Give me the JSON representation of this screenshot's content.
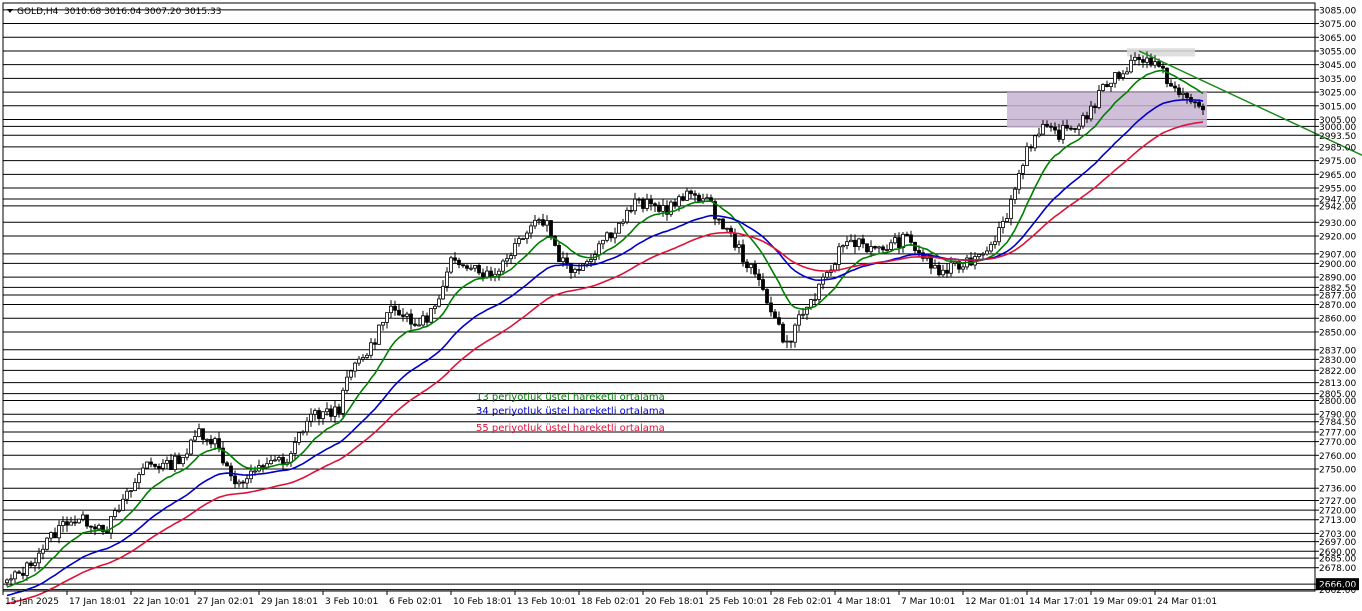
{
  "header": {
    "symbol": "GOLD,H4",
    "ohlc": "3010.68 3016.04 3007.20 3015.33"
  },
  "chart_data": {
    "type": "line",
    "title": "GOLD,H4",
    "ylim": [
      2661,
      3090
    ],
    "grid": false,
    "price_levels": [
      "3085.00",
      "3075.00",
      "3065.00",
      "3055.00",
      "3045.00",
      "3035.00",
      "3025.00",
      "3015.00",
      "3005.00",
      "3000.00",
      "2993.50",
      "2985.00",
      "2975.00",
      "2965.00",
      "2955.00",
      "2947.00",
      "2942.00",
      "2930.00",
      "2920.00",
      "2907.00",
      "2900.00",
      "2890.00",
      "2882.50",
      "2877.00",
      "2870.00",
      "2860.00",
      "2850.00",
      "2837.00",
      "2830.00",
      "2822.00",
      "2813.00",
      "2805.00",
      "2800.00",
      "2790.00",
      "2784.50",
      "2777.00",
      "2770.00",
      "2760.00",
      "2750.00",
      "2736.00",
      "2727.00",
      "2720.00",
      "2713.00",
      "2703.00",
      "2697.00",
      "2690.00",
      "2685.00",
      "2678.00",
      "2666.00",
      "2662.00"
    ],
    "highlighted_level": "2666.00",
    "x_labels": [
      "15 Jan 2025",
      "17 Jan 18:01",
      "22 Jan 10:01",
      "27 Jan 02:01",
      "29 Jan 18:01",
      "3 Feb 10:01",
      "6 Feb 02:01",
      "10 Feb 18:01",
      "13 Feb 10:01",
      "18 Feb 02:01",
      "20 Feb 18:01",
      "25 Feb 10:01",
      "28 Feb 02:01",
      "4 Mar 18:01",
      "7 Mar 10:01",
      "12 Mar 01:01",
      "14 Mar 17:01",
      "19 Mar 09:01",
      "24 Mar 01:01"
    ],
    "bar_count": 300,
    "price_path": [
      [
        0,
        2667
      ],
      [
        5,
        2678
      ],
      [
        10,
        2697
      ],
      [
        15,
        2713
      ],
      [
        20,
        2712
      ],
      [
        25,
        2707
      ],
      [
        30,
        2730
      ],
      [
        35,
        2755
      ],
      [
        40,
        2752
      ],
      [
        45,
        2762
      ],
      [
        48,
        2778
      ],
      [
        52,
        2770
      ],
      [
        55,
        2752
      ],
      [
        58,
        2738
      ],
      [
        62,
        2747
      ],
      [
        66,
        2758
      ],
      [
        70,
        2752
      ],
      [
        73,
        2775
      ],
      [
        76,
        2790
      ],
      [
        80,
        2790
      ],
      [
        83,
        2795
      ],
      [
        86,
        2822
      ],
      [
        89,
        2830
      ],
      [
        92,
        2845
      ],
      [
        95,
        2868
      ],
      [
        98,
        2866
      ],
      [
        101,
        2855
      ],
      [
        104,
        2858
      ],
      [
        108,
        2872
      ],
      [
        111,
        2900
      ],
      [
        114,
        2902
      ],
      [
        117,
        2898
      ],
      [
        121,
        2890
      ],
      [
        125,
        2905
      ],
      [
        129,
        2922
      ],
      [
        132,
        2932
      ],
      [
        135,
        2930
      ],
      [
        138,
        2905
      ],
      [
        141,
        2896
      ],
      [
        145,
        2902
      ],
      [
        149,
        2918
      ],
      [
        153,
        2928
      ],
      [
        157,
        2944
      ],
      [
        161,
        2942
      ],
      [
        165,
        2940
      ],
      [
        169,
        2947
      ],
      [
        172,
        2952
      ],
      [
        175,
        2945
      ],
      [
        178,
        2932
      ],
      [
        182,
        2915
      ],
      [
        186,
        2895
      ],
      [
        189,
        2882
      ],
      [
        192,
        2860
      ],
      [
        195,
        2840
      ],
      [
        198,
        2860
      ],
      [
        201,
        2872
      ],
      [
        205,
        2890
      ],
      [
        209,
        2915
      ],
      [
        213,
        2917
      ],
      [
        217,
        2908
      ],
      [
        221,
        2914
      ],
      [
        225,
        2918
      ],
      [
        229,
        2905
      ],
      [
        233,
        2893
      ],
      [
        237,
        2897
      ],
      [
        241,
        2903
      ],
      [
        245,
        2912
      ],
      [
        249,
        2928
      ],
      [
        252,
        2955
      ],
      [
        255,
        2985
      ],
      [
        259,
        2997
      ],
      [
        263,
        2995
      ],
      [
        267,
        3000
      ],
      [
        271,
        3012
      ],
      [
        275,
        3032
      ],
      [
        279,
        3040
      ],
      [
        283,
        3052
      ],
      [
        287,
        3045
      ],
      [
        290,
        3035
      ],
      [
        293,
        3023
      ],
      [
        296,
        3018
      ],
      [
        299,
        3013
      ]
    ],
    "series": [
      {
        "name": "13 periyotluk üstel hareketli ortalama",
        "color": "#008000",
        "period": 13
      },
      {
        "name": "34 periyotluk üstel hareketli ortalama",
        "color": "#0000c8",
        "period": 34
      },
      {
        "name": "55 periyotluk üstel hareketli ortalama",
        "color": "#dc143c",
        "period": 55
      }
    ],
    "trendline": {
      "color": "#1a8c1a",
      "from": [
        283,
        3055
      ],
      "to": [
        360,
        2950
      ]
    },
    "zones": [
      {
        "color": "#c8b4d2",
        "from": [
          250,
          3025
        ],
        "to": [
          300,
          2999
        ]
      },
      {
        "color": "#d9d9d9",
        "from": [
          280,
          3057
        ],
        "to": [
          297,
          3051
        ]
      }
    ]
  }
}
